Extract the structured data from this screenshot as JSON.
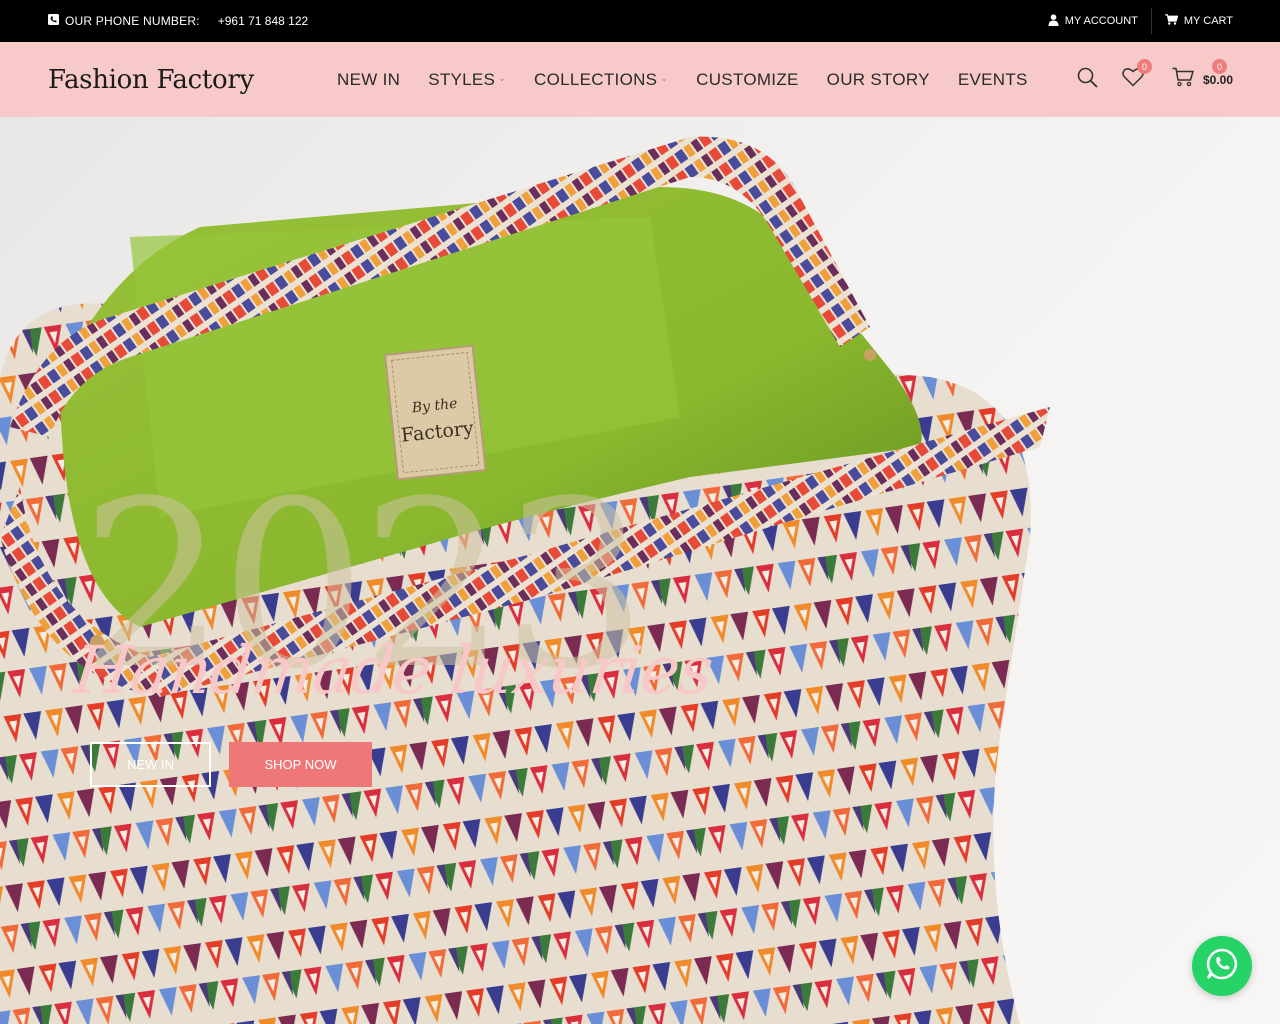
{
  "topbar": {
    "phone_label": "OUR PHONE NUMBER:",
    "phone_number": "+961 71 848 122",
    "account_label": "MY ACCOUNT",
    "cart_label": "MY CART"
  },
  "header": {
    "logo": "Fashion Factory",
    "nav": [
      {
        "label": "NEW IN",
        "has_dropdown": false
      },
      {
        "label": "STYLES",
        "has_dropdown": true
      },
      {
        "label": "COLLECTIONS",
        "has_dropdown": true
      },
      {
        "label": "CUSTOMIZE",
        "has_dropdown": false
      },
      {
        "label": "OUR STORY",
        "has_dropdown": false
      },
      {
        "label": "EVENTS",
        "has_dropdown": false
      }
    ],
    "wishlist_count": "0",
    "cart_count": "0",
    "cart_total": "$0.00"
  },
  "hero": {
    "year": "2023",
    "tagline": "Handmade luxuries",
    "primary_button": "NEW IN",
    "secondary_button": "SHOP NOW",
    "label_text": "By the Factory"
  },
  "colors": {
    "topbar_bg": "#000000",
    "header_bg": "#f7c9c9",
    "accent": "#f07777",
    "whatsapp": "#25d366"
  },
  "icons": [
    "phone-icon",
    "user-icon",
    "cart-icon",
    "search-icon",
    "heart-icon",
    "whatsapp-icon"
  ]
}
